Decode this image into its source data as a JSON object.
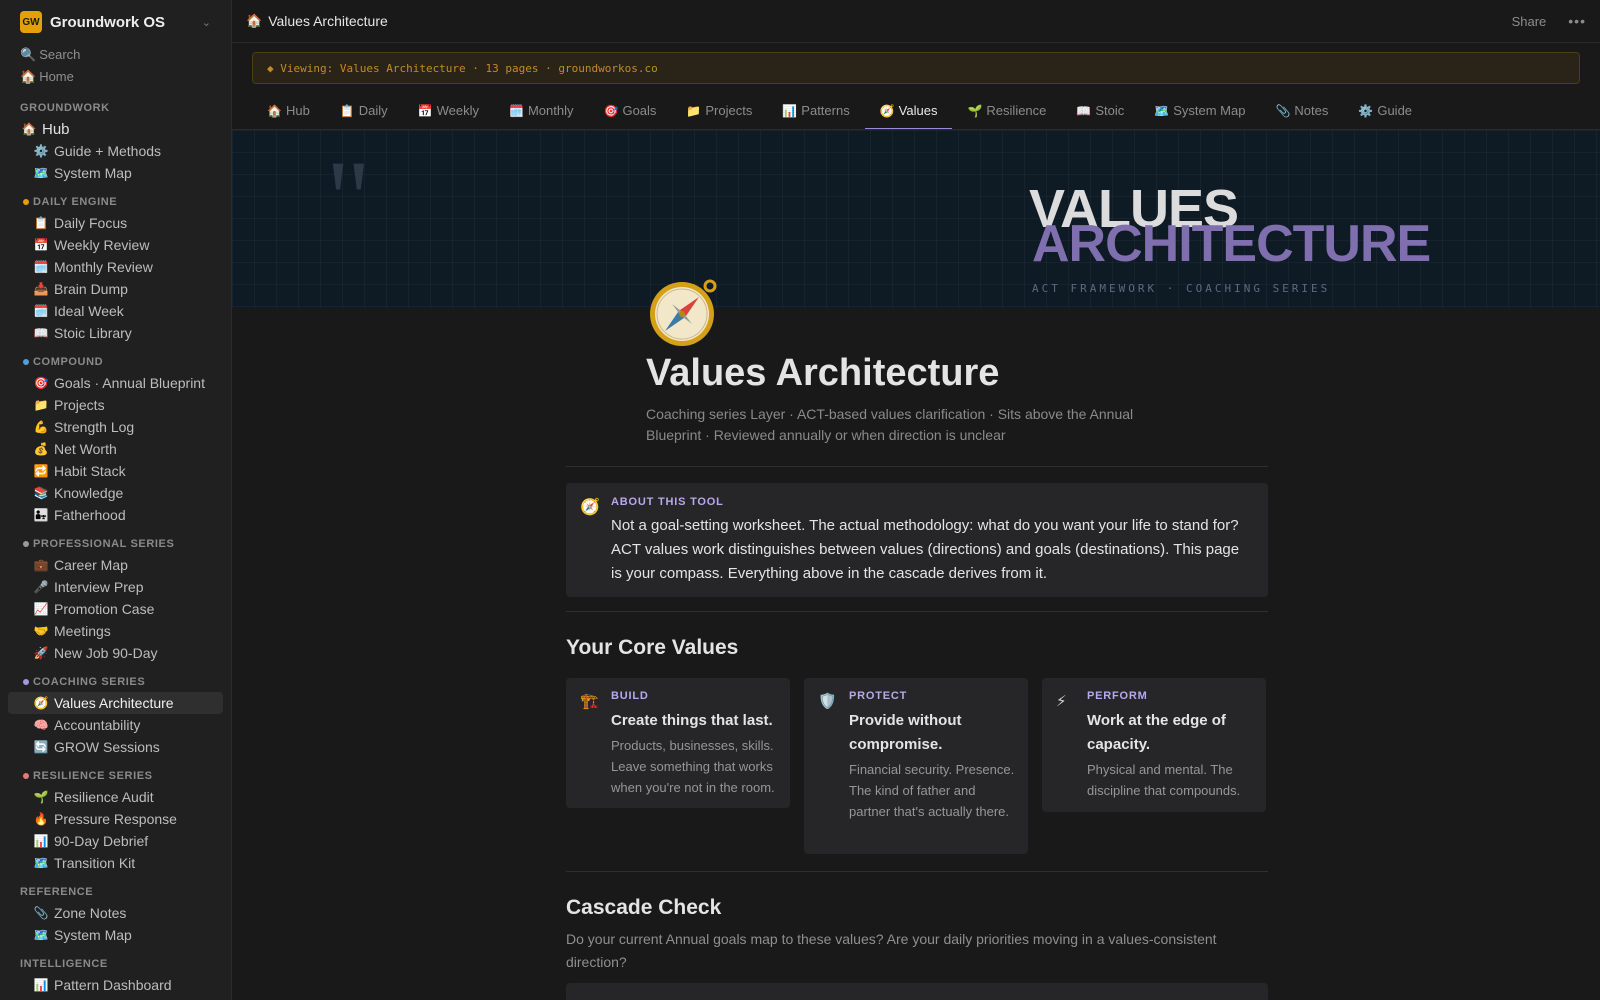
{
  "workspace": {
    "logo": "GW",
    "name": "Groundwork OS",
    "chevron": "⌄"
  },
  "quick": [
    {
      "icon": "🔍",
      "label": "Search"
    },
    {
      "icon": "🏠",
      "label": "Home"
    }
  ],
  "sidebar": {
    "groups": [
      {
        "title": "GROUNDWORK",
        "dot": "",
        "items": [
          {
            "icon": "🏠",
            "label": "Hub",
            "top": true
          },
          {
            "icon": "⚙️",
            "label": "Guide + Methods"
          },
          {
            "icon": "🗺️",
            "label": "System Map"
          }
        ]
      },
      {
        "title": "DAILY ENGINE",
        "dot": "#e3a008",
        "items": [
          {
            "icon": "📋",
            "label": "Daily Focus"
          },
          {
            "icon": "📅",
            "label": "Weekly Review"
          },
          {
            "icon": "🗓️",
            "label": "Monthly Review"
          },
          {
            "icon": "📥",
            "label": "Brain Dump"
          },
          {
            "icon": "🗓️",
            "label": "Ideal Week"
          },
          {
            "icon": "📖",
            "label": "Stoic Library"
          }
        ]
      },
      {
        "title": "COMPOUND",
        "dot": "#5b9bd5",
        "items": [
          {
            "icon": "🎯",
            "label": "Goals · Annual Blueprint"
          },
          {
            "icon": "📁",
            "label": "Projects"
          },
          {
            "icon": "💪",
            "label": "Strength Log"
          },
          {
            "icon": "💰",
            "label": "Net Worth"
          },
          {
            "icon": "🔁",
            "label": "Habit Stack"
          },
          {
            "icon": "📚",
            "label": "Knowledge"
          },
          {
            "icon": "👨‍👧",
            "label": "Fatherhood"
          }
        ]
      },
      {
        "title": "PROFESSIONAL SERIES",
        "dot": "#9a9a9a",
        "items": [
          {
            "icon": "💼",
            "label": "Career Map"
          },
          {
            "icon": "🎤",
            "label": "Interview Prep"
          },
          {
            "icon": "📈",
            "label": "Promotion Case"
          },
          {
            "icon": "🤝",
            "label": "Meetings"
          },
          {
            "icon": "🚀",
            "label": "New Job 90-Day"
          }
        ]
      },
      {
        "title": "COACHING SERIES",
        "dot": "#a998e0",
        "items": [
          {
            "icon": "🧭",
            "label": "Values Architecture",
            "active": true
          },
          {
            "icon": "🧠",
            "label": "Accountability"
          },
          {
            "icon": "🔄",
            "label": "GROW Sessions"
          }
        ]
      },
      {
        "title": "RESILIENCE SERIES",
        "dot": "#e07b7b",
        "items": [
          {
            "icon": "🌱",
            "label": "Resilience Audit"
          },
          {
            "icon": "🔥",
            "label": "Pressure Response"
          },
          {
            "icon": "📊",
            "label": "90-Day Debrief"
          },
          {
            "icon": "🗺️",
            "label": "Transition Kit"
          }
        ]
      },
      {
        "title": "REFERENCE",
        "dot": "",
        "items": [
          {
            "icon": "📎",
            "label": "Zone Notes"
          },
          {
            "icon": "🗺️",
            "label": "System Map"
          }
        ]
      },
      {
        "title": "INTELLIGENCE",
        "dot": "",
        "items": [
          {
            "icon": "📊",
            "label": "Pattern Dashboard"
          }
        ]
      }
    ]
  },
  "topbar": {
    "icon": "🏠",
    "title": "Values Architecture",
    "share": "Share",
    "more": "•••"
  },
  "banner": "◆ Viewing: Values Architecture · 13 pages · groundworkos.co",
  "tabs": [
    {
      "icon": "🏠",
      "label": "Hub"
    },
    {
      "icon": "📋",
      "label": "Daily"
    },
    {
      "icon": "📅",
      "label": "Weekly"
    },
    {
      "icon": "🗓️",
      "label": "Monthly"
    },
    {
      "icon": "🎯",
      "label": "Goals"
    },
    {
      "icon": "📁",
      "label": "Projects"
    },
    {
      "icon": "📊",
      "label": "Patterns"
    },
    {
      "icon": "🧭",
      "label": "Values",
      "active": true
    },
    {
      "icon": "🌱",
      "label": "Resilience"
    },
    {
      "icon": "📖",
      "label": "Stoic"
    },
    {
      "icon": "🗺️",
      "label": "System Map"
    },
    {
      "icon": "📎",
      "label": "Notes"
    },
    {
      "icon": "⚙️",
      "label": "Guide"
    }
  ],
  "hero": {
    "quote_mark": "\"",
    "title_line1": "VALUES",
    "title_line2": "ARCHITECTURE",
    "tagline": "ACT FRAMEWORK · COACHING SERIES"
  },
  "page": {
    "icon": "compass-icon",
    "title": "Values Architecture",
    "subtitle": "Coaching series Layer · ACT-based values clarification · Sits above the Annual Blueprint · Reviewed annually or when direction is unclear"
  },
  "about": {
    "icon": "🧭",
    "label": "ABOUT THIS TOOL",
    "body": "Not a goal-setting worksheet. The actual methodology: what do you want your life to stand for? ACT values work distinguishes between values (directions) and goals (destinations). This page is your compass. Everything above in the cascade derives from it."
  },
  "core_values": {
    "heading": "Your Core Values",
    "cards": [
      {
        "icon": "🏗️",
        "label": "BUILD",
        "head": "Create things that last.",
        "desc": "Products, businesses, skills. Leave something that works when you're not in the room."
      },
      {
        "icon": "🛡️",
        "label": "PROTECT",
        "head": "Provide without compromise.",
        "desc": "Financial security. Presence. The kind of father and partner that's actually there."
      },
      {
        "icon": "⚡",
        "label": "PERFORM",
        "head": "Work at the edge of capacity.",
        "desc": "Physical and mental. The discipline that compounds."
      }
    ]
  },
  "cascade": {
    "heading": "Cascade Check",
    "desc": "Do your current Annual goals map to these values? Are your daily priorities moving in a values-consistent direction?"
  },
  "colors": {
    "accent": "#b7a8ef",
    "brand": "#e3a008",
    "banner_text": "#c48a25"
  }
}
